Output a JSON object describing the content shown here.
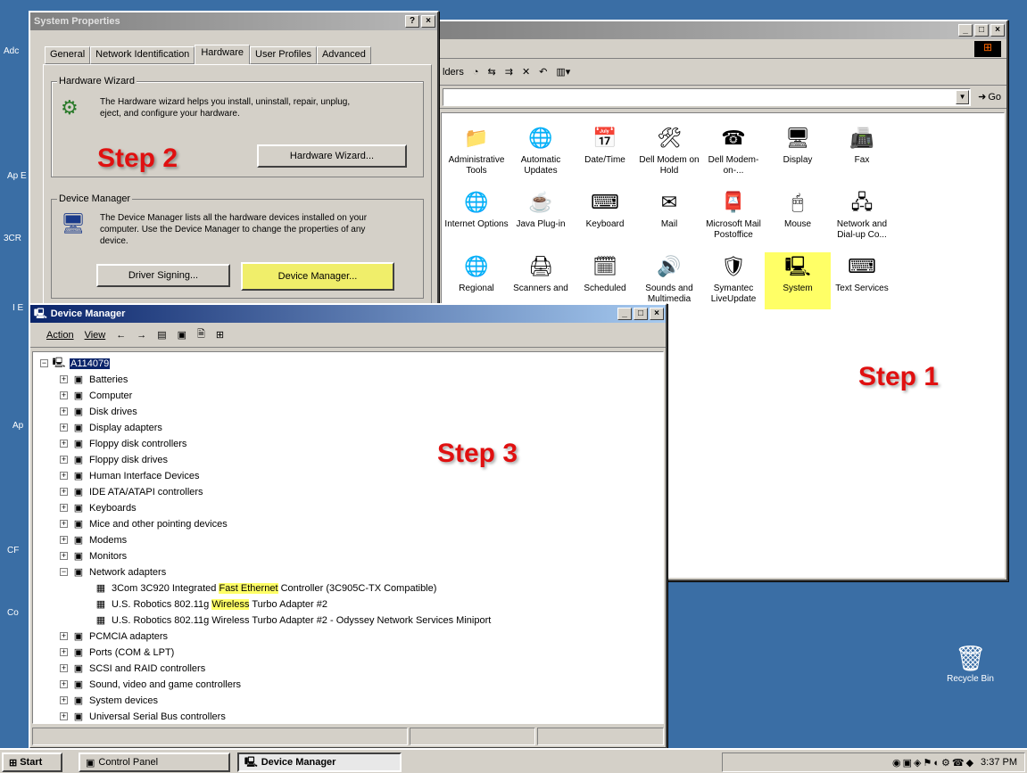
{
  "desktop": {
    "left_labels": [
      "Adc",
      "Ap E",
      "3CR",
      "I E",
      "Ap",
      "CF",
      "Co"
    ],
    "recycle_bin": "Recycle Bin"
  },
  "control_panel": {
    "address_go": "Go",
    "toolbar_text": "lders",
    "items": [
      {
        "label": "Administrative Tools",
        "icon": "folder-tools-icon"
      },
      {
        "label": "Automatic Updates",
        "icon": "globe-icon"
      },
      {
        "label": "Date/Time",
        "icon": "calendar-icon"
      },
      {
        "label": "Dell Modem on Hold",
        "icon": "tools-icon"
      },
      {
        "label": "Dell Modem-on-...",
        "icon": "phone-icon"
      },
      {
        "label": "Display",
        "icon": "monitor-icon"
      },
      {
        "label": "Fax",
        "icon": "fax-icon"
      },
      {
        "label": "Internet Options",
        "icon": "ie-icon"
      },
      {
        "label": "Java Plug-in",
        "icon": "java-icon"
      },
      {
        "label": "Keyboard",
        "icon": "keyboard-icon"
      },
      {
        "label": "Mail",
        "icon": "mail-icon"
      },
      {
        "label": "Microsoft Mail Postoffice",
        "icon": "postoffice-icon"
      },
      {
        "label": "Mouse",
        "icon": "mouse-icon"
      },
      {
        "label": "Network and Dial-up Co...",
        "icon": "network-icon"
      },
      {
        "label": "Regional",
        "icon": "globe-icon"
      },
      {
        "label": "Scanners and",
        "icon": "scanner-icon"
      },
      {
        "label": "Scheduled",
        "icon": "scheduled-icon"
      },
      {
        "label": "Sounds and Multimedia",
        "icon": "speaker-icon"
      },
      {
        "label": "Symantec LiveUpdate",
        "icon": "symantec-icon"
      },
      {
        "label": "System",
        "icon": "system-icon"
      },
      {
        "label": "Text Services",
        "icon": "text-services-icon"
      }
    ]
  },
  "system_properties": {
    "title": "System Properties",
    "tabs": [
      "General",
      "Network Identification",
      "Hardware",
      "User Profiles",
      "Advanced"
    ],
    "hw_wizard_group": "Hardware Wizard",
    "hw_wizard_text": "The Hardware wizard helps you install, uninstall, repair, unplug, eject, and configure your hardware.",
    "hw_wizard_button": "Hardware Wizard...",
    "dm_group": "Device Manager",
    "dm_text": "The Device Manager lists all the hardware devices installed on your computer. Use the Device Manager to change the properties of any device.",
    "driver_signing_button": "Driver Signing...",
    "device_manager_button": "Device Manager..."
  },
  "device_manager": {
    "title": "Device Manager",
    "menu": [
      "Action",
      "View"
    ],
    "root": "A114079",
    "categories": [
      "Batteries",
      "Computer",
      "Disk drives",
      "Display adapters",
      "Floppy disk controllers",
      "Floppy disk drives",
      "Human Interface Devices",
      "IDE ATA/ATAPI controllers",
      "Keyboards",
      "Mice and other pointing devices",
      "Modems",
      "Monitors",
      "Network adapters"
    ],
    "network_children": [
      "3Com 3C920 Integrated Fast Ethernet Controller (3C905C-TX Compatible)",
      "U.S. Robotics 802.11g Wireless Turbo Adapter #2",
      "U.S. Robotics 802.11g Wireless Turbo Adapter #2 - Odyssey Network Services Miniport"
    ],
    "categories_after": [
      "PCMCIA adapters",
      "Ports (COM & LPT)",
      "SCSI and RAID controllers",
      "Sound, video and game controllers",
      "System devices",
      "Universal Serial Bus controllers"
    ]
  },
  "steps": {
    "step1": "Step 1",
    "step2": "Step 2",
    "step3": "Step 3"
  },
  "taskbar": {
    "start": "Start",
    "tasks": [
      "Control Panel",
      "Device Manager"
    ],
    "clock": "3:37 PM"
  },
  "colors": {
    "desktop": "#3a6ea5",
    "step": "#e01010",
    "highlight": "#ffff66"
  }
}
